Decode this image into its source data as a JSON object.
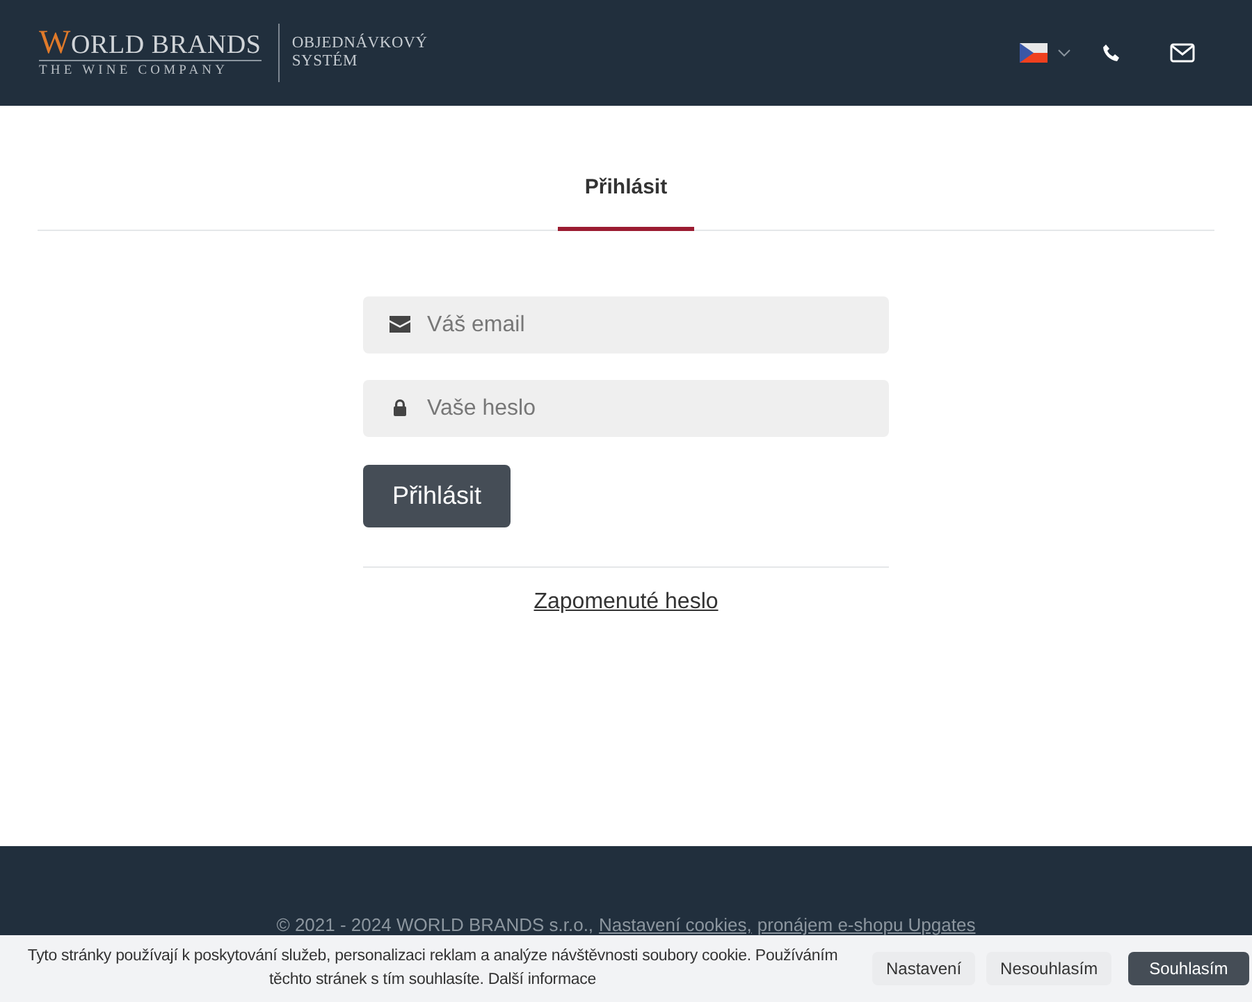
{
  "header": {
    "logo": {
      "title": "WORLD BRANDS",
      "subtitle": "THE WINE COMPANY"
    },
    "system_name": "OBJEDNÁVKOVÝ SYSTÉM"
  },
  "tabs": [
    {
      "label": "Přihlásit",
      "selected": true
    }
  ],
  "login_form": {
    "email": {
      "placeholder": "Váš email"
    },
    "password": {
      "placeholder": "Vaše heslo"
    },
    "submit": "Přihlásit",
    "forgot_link": "Zapomenuté heslo"
  },
  "footer": {
    "copyright": "© 2021 - 2024 WORLD BRANDS s.r.o.,",
    "links": [
      "Nastavení cookies,",
      "pronájem e-shopu Upgates"
    ]
  },
  "cookie_bar": {
    "message": "Tyto stránky používají k poskytování služeb, personalizaci reklam a analýze návštěvnosti soubory cookie. Používáním těchto stránek s tím souhlasíte.",
    "more_link": "Další informace",
    "buttons": [
      {
        "label": "Nastavení",
        "kind": "light"
      },
      {
        "label": "Nesouhlasím",
        "kind": "light"
      },
      {
        "label": "Souhlasím",
        "kind": "dark"
      }
    ]
  }
}
